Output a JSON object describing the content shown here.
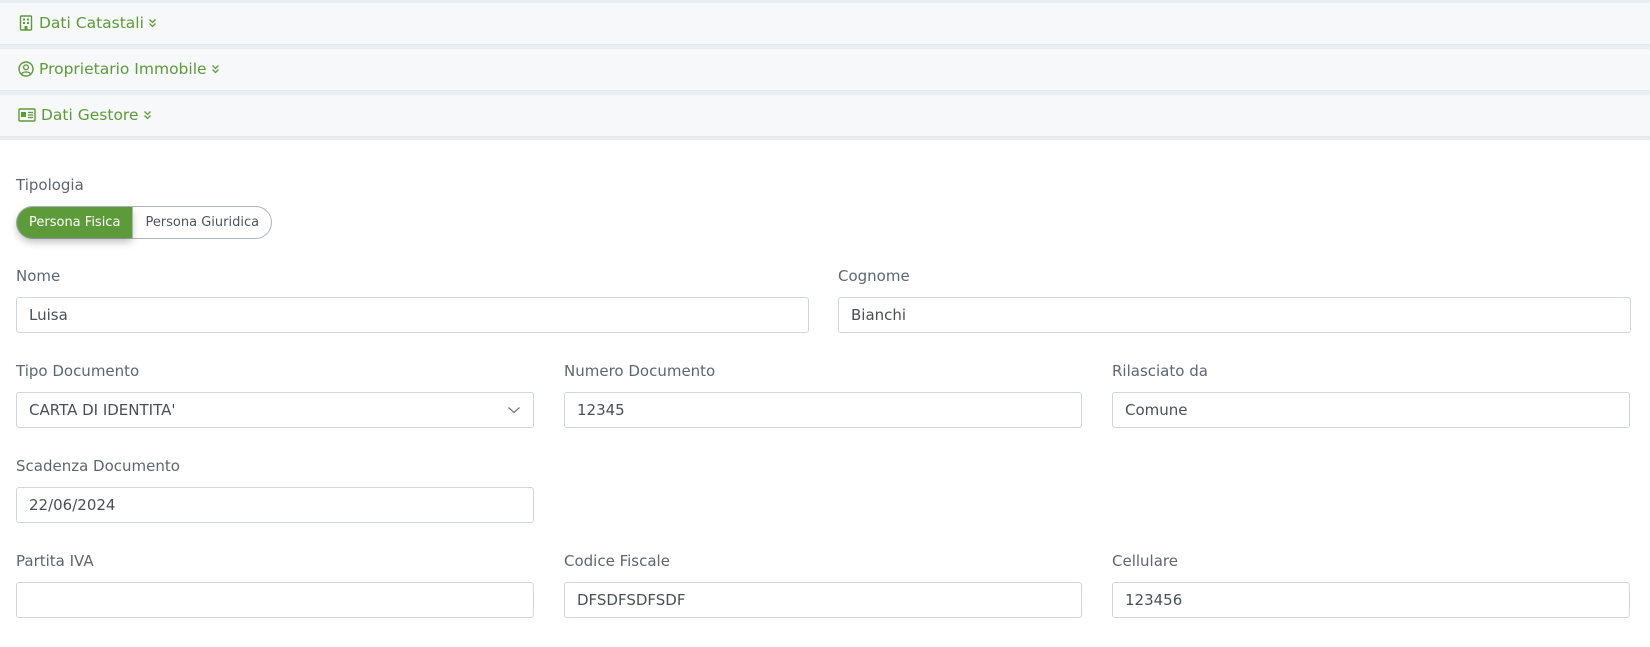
{
  "sections": {
    "catastali": {
      "title": "Dati Catastali"
    },
    "proprietario": {
      "title": "Proprietario Immobile"
    },
    "gestore": {
      "title": "Dati Gestore"
    }
  },
  "form": {
    "tipologia": {
      "label": "Tipologia",
      "options": [
        "Persona Fisica",
        "Persona Giuridica"
      ],
      "selected": "Persona Fisica"
    },
    "nome": {
      "label": "Nome",
      "value": "Luisa"
    },
    "cognome": {
      "label": "Cognome",
      "value": "Bianchi"
    },
    "tipo_documento": {
      "label": "Tipo Documento",
      "value": "CARTA DI IDENTITA'"
    },
    "numero_documento": {
      "label": "Numero Documento",
      "value": "12345"
    },
    "rilasciato_da": {
      "label": "Rilasciato da",
      "value": "Comune"
    },
    "scadenza_documento": {
      "label": "Scadenza Documento",
      "value": "22/06/2024"
    },
    "partita_iva": {
      "label": "Partita IVA",
      "value": ""
    },
    "codice_fiscale": {
      "label": "Codice Fiscale",
      "value": "DFSDFSDFSDF"
    },
    "cellulare": {
      "label": "Cellulare",
      "value": "123456"
    }
  },
  "colors": {
    "accent": "#5d9a3a",
    "header_bg": "#f7f8f9",
    "page_bg": "#e9eef2"
  },
  "icons": {
    "catastali": "building-icon",
    "proprietario": "user-circle-icon",
    "gestore": "id-card-icon",
    "expand": "chevron-double-down-icon"
  }
}
